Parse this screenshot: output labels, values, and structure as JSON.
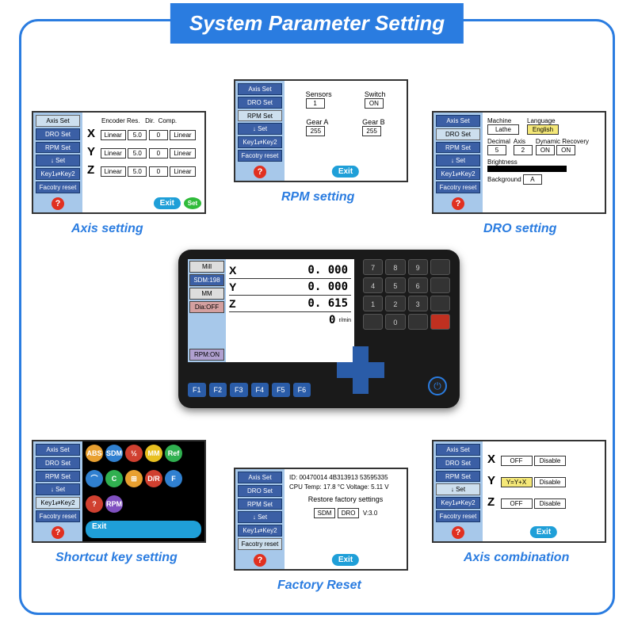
{
  "title": "System Parameter Setting",
  "sidebar_buttons": [
    "Axis Set",
    "DRO Set",
    "RPM Set",
    "↓ Set",
    "Key1⇄Key2",
    "Facotry reset"
  ],
  "captions": {
    "axis": "Axis setting",
    "rpm": "RPM setting",
    "dro": "DRO setting",
    "shortcut": "Shortcut key setting",
    "factory": "Factory Reset",
    "combo": "Axis combination"
  },
  "exit_label": "Exit",
  "set_label": "Set",
  "help_label": "?",
  "axis_panel": {
    "headers": [
      "Encoder Res.",
      "Dir.",
      "Comp."
    ],
    "rows": [
      {
        "axis": "X",
        "type": "Linear",
        "res": "5.0",
        "dir": "0",
        "comp": "Linear"
      },
      {
        "axis": "Y",
        "type": "Linear",
        "res": "5.0",
        "dir": "0",
        "comp": "Linear"
      },
      {
        "axis": "Z",
        "type": "Linear",
        "res": "5.0",
        "dir": "0",
        "comp": "Linear"
      }
    ]
  },
  "rpm_panel": {
    "sensors_lbl": "Sensors",
    "sensors": "1",
    "switch_lbl": "Switch",
    "switch": "ON",
    "geara_lbl": "Gear A",
    "geara": "255",
    "gearb_lbl": "Gear B",
    "gearb": "255"
  },
  "dro_panel": {
    "machine_lbl": "Machine",
    "machine": "Lathe",
    "language_lbl": "Language",
    "language": "English",
    "decimal_lbl": "Decimal",
    "decimal": "5",
    "axis_lbl": "Axis",
    "axis": "2",
    "dynrec_lbl": "Dynamic Recovery",
    "dynrec_on": "ON",
    "dynrec_on2": "ON",
    "bright_lbl": "Brightness",
    "bg_lbl": "Background",
    "bg": "A"
  },
  "factory_panel": {
    "id_lbl": "ID:",
    "id": "00470014 4B313913 53595335",
    "cpu": "CPU Temp: 17.8 °C   Voltage: 5.11 V",
    "restore": "Restore factory settings",
    "sdm": "SDM",
    "dro": "DRO",
    "ver": "V:3.0"
  },
  "combo_panel": {
    "rows": [
      {
        "axis": "X",
        "v1": "OFF",
        "v2": "Disable"
      },
      {
        "axis": "Y",
        "v1": "Y=Y+X",
        "v2": "Disable"
      },
      {
        "axis": "Z",
        "v1": "OFF",
        "v2": "Disable"
      }
    ]
  },
  "device": {
    "side": [
      "Mill",
      "SDM:198",
      "MM",
      "Dia:OFF",
      "RPM:ON"
    ],
    "rows": [
      {
        "axis": "X",
        "val": "0. 000"
      },
      {
        "axis": "Y",
        "val": "0. 000"
      },
      {
        "axis": "Z",
        "val": "0. 615"
      }
    ],
    "rpm_row": "0",
    "rpm_unit": "r/min",
    "fkeys": [
      "F1",
      "F2",
      "F3",
      "F4",
      "F5",
      "F6"
    ],
    "keys": [
      "7",
      "8",
      "9",
      "",
      "4",
      "5",
      "6",
      "",
      "1",
      "2",
      "3",
      "",
      "",
      "0",
      "",
      ""
    ]
  }
}
